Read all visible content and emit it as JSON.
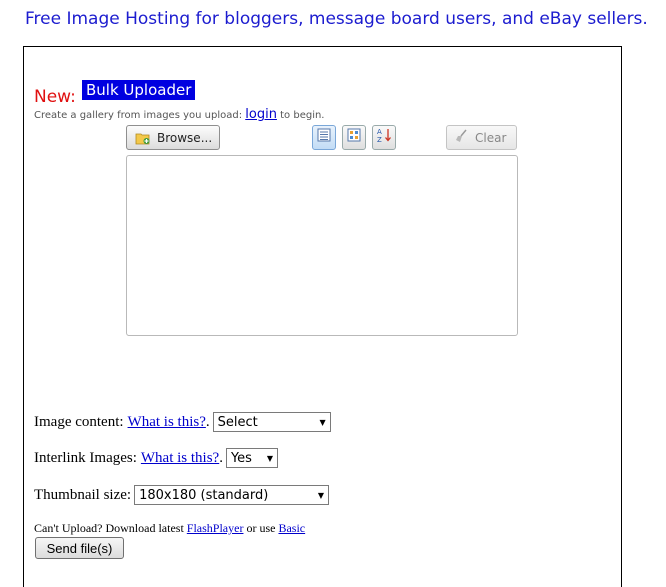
{
  "header": {
    "tagline": "Free Image Hosting for bloggers, message board users, and eBay sellers."
  },
  "uploader": {
    "new_label": "New:",
    "badge": "Bulk Uploader",
    "hint_prefix": "Create a gallery from images you upload:",
    "hint_link": "login",
    "hint_suffix": "to begin.",
    "browse_label": "Browse...",
    "clear_label": "Clear",
    "icons": [
      "folder-add-icon",
      "list-view-icon",
      "thumbnail-view-icon",
      "sort-az-icon",
      "broom-icon"
    ]
  },
  "form": {
    "image_content_label": "Image content:",
    "image_content_help": "What is this?",
    "image_content_value": "Select",
    "interlink_label": "Interlink Images:",
    "interlink_help": "What is this?",
    "interlink_value": "Yes",
    "thumb_label": "Thumbnail size:",
    "thumb_value": "180x180 (standard)",
    "cant_upload_prefix": "Can't Upload? Download latest",
    "flash_link": "FlashPlayer",
    "or_use": "or use",
    "basic_link": "Basic",
    "send_label": "Send file(s)"
  },
  "colors": {
    "tagline": "#1c1ccf",
    "new_label": "#e01010",
    "badge_bg": "#0000e0",
    "link": "#0000cc"
  }
}
